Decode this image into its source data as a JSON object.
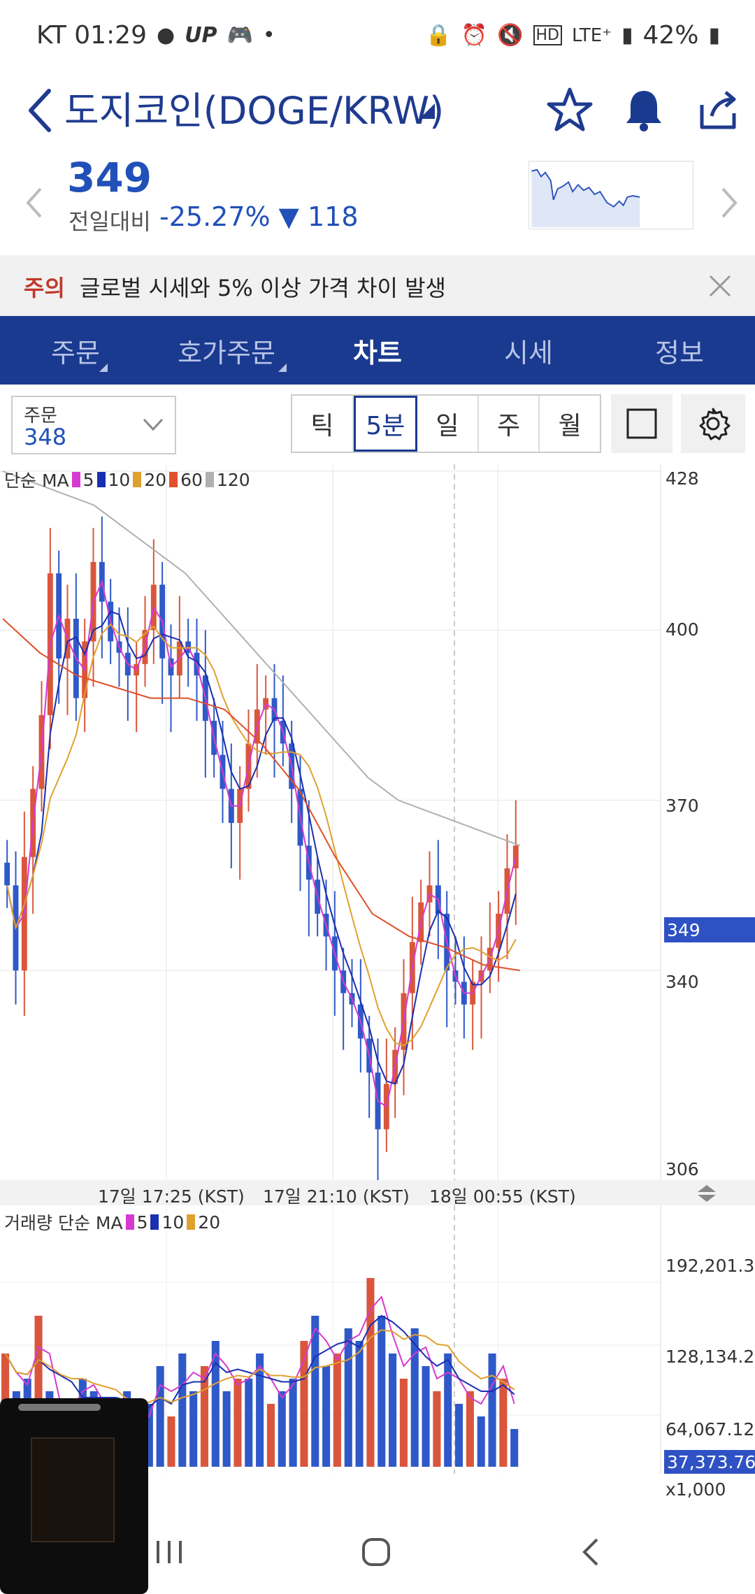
{
  "status": {
    "carrier_time": "KT 01:29",
    "apps": [
      "TALK",
      "UP"
    ],
    "network": "LTE⁺",
    "battery": "42%"
  },
  "header": {
    "title": "도지코인(DOGE/KRW)"
  },
  "price": {
    "current": "349",
    "change_label": "전일대비",
    "change_text": "-25.27% ▼ 118"
  },
  "notice": {
    "tag": "주의",
    "message": "글로벌 시세와 5% 이상 가격 차이 발생"
  },
  "tabs": [
    {
      "label": "주문"
    },
    {
      "label": "호가주문"
    },
    {
      "label": "차트"
    },
    {
      "label": "시세"
    },
    {
      "label": "정보"
    }
  ],
  "controls": {
    "order_label": "주문",
    "order_value": "348",
    "periods": [
      "틱",
      "5분",
      "일",
      "주",
      "월"
    ],
    "active_period": "5분"
  },
  "legend": {
    "price": {
      "label": "단순 MA",
      "items": [
        {
          "n": "5",
          "color": "#d63ad0"
        },
        {
          "n": "10",
          "color": "#1a2fb0"
        },
        {
          "n": "20",
          "color": "#e0a030"
        },
        {
          "n": "60",
          "color": "#e0502a"
        },
        {
          "n": "120",
          "color": "#b0b0b0"
        }
      ]
    },
    "volume": {
      "label": "거래량 단순 MA",
      "items": [
        {
          "n": "5",
          "color": "#d63ad0"
        },
        {
          "n": "10",
          "color": "#1a2fb0"
        },
        {
          "n": "20",
          "color": "#e0a030"
        }
      ]
    }
  },
  "chart_data": [
    {
      "type": "candlestick",
      "y_ticks": [
        "428",
        "400",
        "370",
        "340",
        "306"
      ],
      "ylim": [
        306,
        428
      ],
      "current_price_label": "349",
      "x_ticks": [
        "17일 17:25 (KST)",
        "17일 21:10 (KST)",
        "18일 00:55 (KST)"
      ],
      "close_series": [
        355,
        340,
        360,
        372,
        385,
        410,
        395,
        402,
        388,
        398,
        412,
        405,
        398,
        396,
        392,
        394,
        400,
        408,
        395,
        392,
        398,
        396,
        392,
        384,
        378,
        372,
        366,
        372,
        380,
        386,
        388,
        384,
        380,
        372,
        362,
        356,
        350,
        346,
        340,
        336,
        334,
        328,
        322,
        312,
        320,
        326,
        336,
        345,
        352,
        355,
        350,
        340,
        338,
        334,
        338,
        340,
        344,
        350,
        358,
        362
      ],
      "ma120": [
        428,
        426,
        424,
        422,
        418,
        414,
        410,
        404,
        398,
        392,
        386,
        380,
        374,
        370,
        368,
        366,
        364,
        362
      ],
      "ma60": [
        402,
        396,
        392,
        390,
        388,
        388,
        386,
        380,
        372,
        360,
        350,
        346,
        344,
        341,
        340
      ]
    },
    {
      "type": "bar",
      "series_name": "거래량",
      "y_ticks": [
        "192,201.377",
        "128,134.251",
        "64,067.126"
      ],
      "current_volume_label": "37,373.766",
      "unit_label": "x1,000",
      "values": [
        90,
        60,
        70,
        120,
        60,
        40,
        50,
        70,
        60,
        40,
        50,
        60,
        30,
        50,
        80,
        40,
        90,
        60,
        80,
        100,
        60,
        70,
        70,
        90,
        50,
        60,
        70,
        100,
        120,
        80,
        90,
        110,
        100,
        150,
        120,
        90,
        70,
        110,
        80,
        60,
        90,
        50,
        60,
        40,
        90,
        70,
        30
      ]
    }
  ]
}
